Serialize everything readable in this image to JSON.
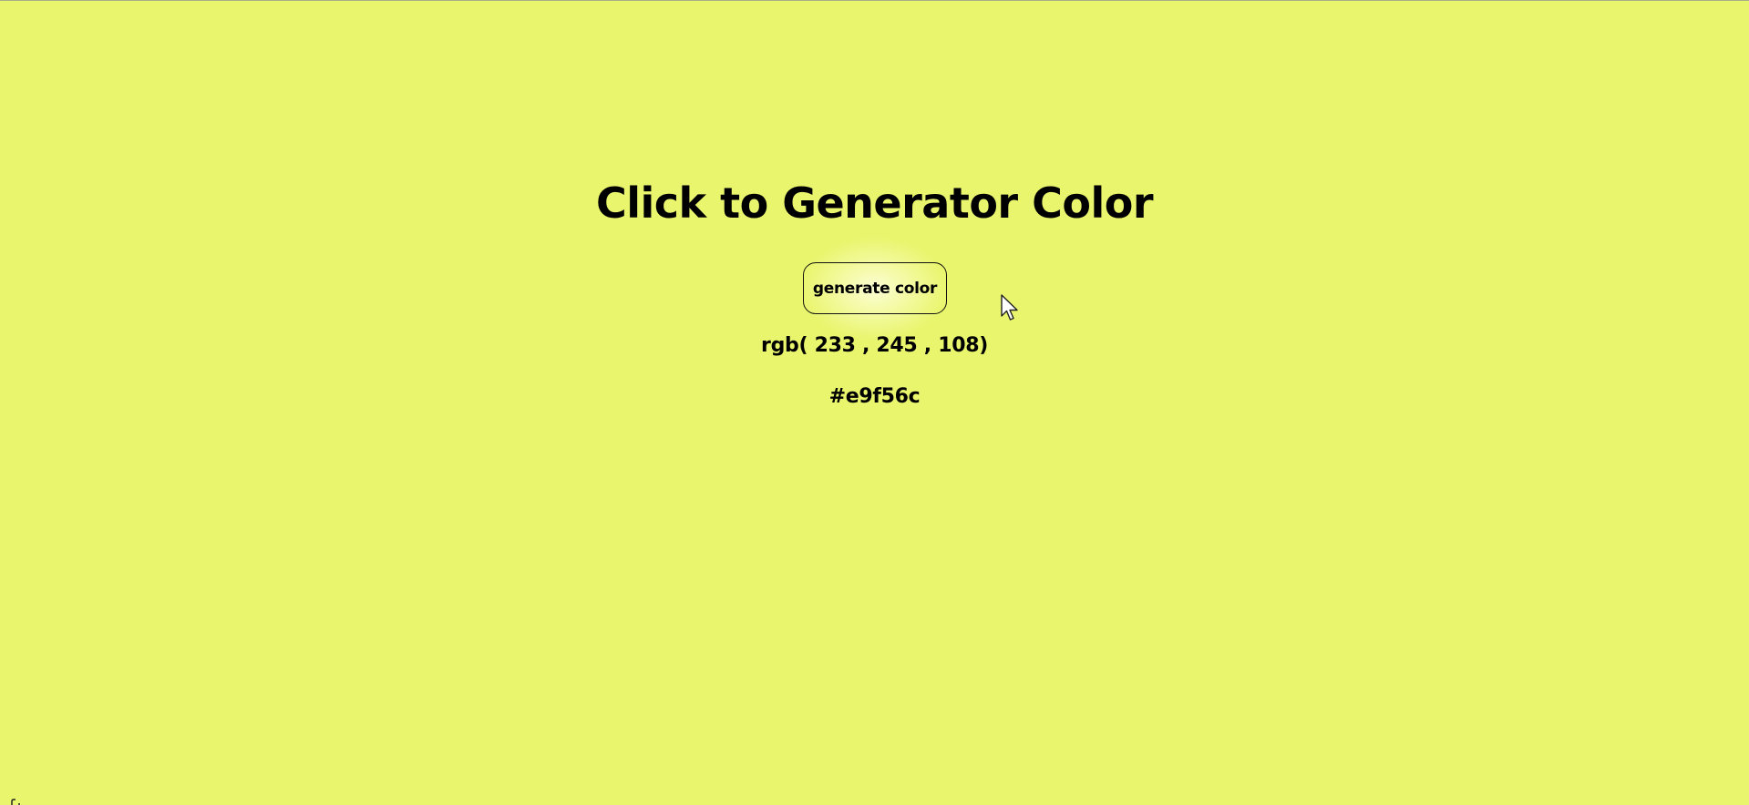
{
  "page": {
    "background_color": "#e9f56c",
    "title": "Click to Generator Color"
  },
  "generator": {
    "button_label": "generate color",
    "rgb_display": "rgb( 233 , 245 , 108)",
    "hex_display": "#e9f56c"
  },
  "icons": {
    "cursor": "mouse-pointer-icon"
  }
}
